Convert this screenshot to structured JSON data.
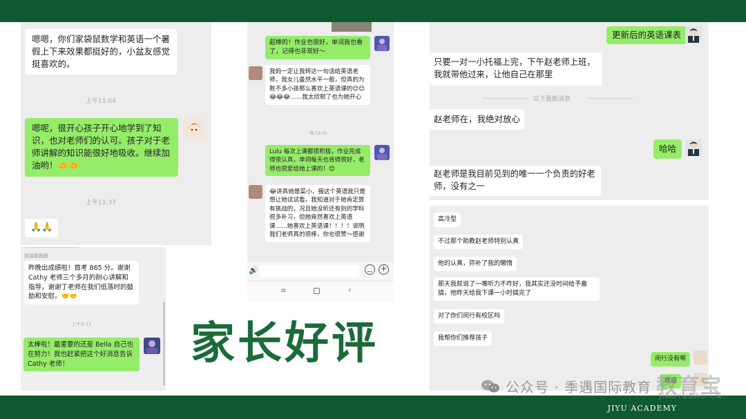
{
  "colors": {
    "band": "#0f5a32",
    "title": "#1b6b3a",
    "bubble_green": "#95ec69",
    "bubble_white": "#ffffff",
    "panel_bg": "#ededed"
  },
  "title": "家长好评",
  "footer": {
    "academy": "JIYU ACADEMY",
    "wechat_official": "公众号 · 季遇国际教育",
    "watermark_logo": "教育宝",
    "watermark_url": "JIAOYUBAO.CN"
  },
  "chat1": {
    "msg1": "嗯嗯，你们家袋鼠数学和英语一个暑假上下来效果都挺好的，小盆友感觉挺喜欢的。",
    "time1": "上午11:04",
    "msg2": "嗯呢，很开心孩子开心地学到了知识，也对老师们的认可。孩子对于老师讲解的知识能很好地吸收。继续加油哟！🤝🤝",
    "time2": "上午11:37",
    "msg3": "🙏🙏"
  },
  "chat2": {
    "sender": "刘泽欧妈妈",
    "msg1": "昨晚出成绩啦！首考 865 分。谢谢 Cathy 老师三个多月的耐心讲解和指导，谢谢丁老师在我们低落时的鼓励和安慰。🤝🤝",
    "time1": "上午9:11",
    "msg2": "太棒啦！最重要的还是 Bella 自己也在努力！我也赶紧把这个好消息告诉 Cathy 老师！"
  },
  "chat3": {
    "msg1": "超棒的！作业也很好，单词我也看了，记得也非常好～",
    "msg2": "我妈一定让我转达一句话给英语老师，我女儿虽然水平一般，但真的为数不多小孩那么喜欢上英语课的😊😊😂😂😂……我太欣慰了也为她开心",
    "time1": "晚上9:01",
    "msg3": "Lulu 每次上课都很积极，作业完成得很认真，单词每天也背得很好，老师也很爱给她上课的！😊",
    "msg4": "😂讲真她是菜小，报这个英语我只是想让她试试看。我知道对于她肯定算有挑战的，况且她没听还有别的学科很多补习，但她竟然喜欢上英语课……她喜欢上英语课！！！！说明我们老师真的很棒，你也很赞～感谢"
  },
  "chat4": {
    "msg1": "更新后的英语课表",
    "msg2": "只要一对一小托福上完，下午赵老师上班，我就带他过来，让他自己在那里",
    "divider": "以下是新消息",
    "msg3": "赵老师在，我绝对放心",
    "msg4": "哈哈",
    "msg5": "赵老师是我目前见到的唯一一个负责的好老师，没有之一"
  },
  "chat5": {
    "msg1": "高冷型",
    "msg2": "不过那个助教赵老师特别认真",
    "msg3": "他的认真，弥补了我的懒惰",
    "msg4": "那天我就说了一嘴听力不咋好，我其实还没时间给予嘉搞，他昨天给我下课一小时搞完了",
    "msg5": "对了你们闵行有校区吗",
    "msg6": "我帮你们推荐孩子",
    "msg7": "闵行没有啊",
    "msg8": "欢迎"
  }
}
